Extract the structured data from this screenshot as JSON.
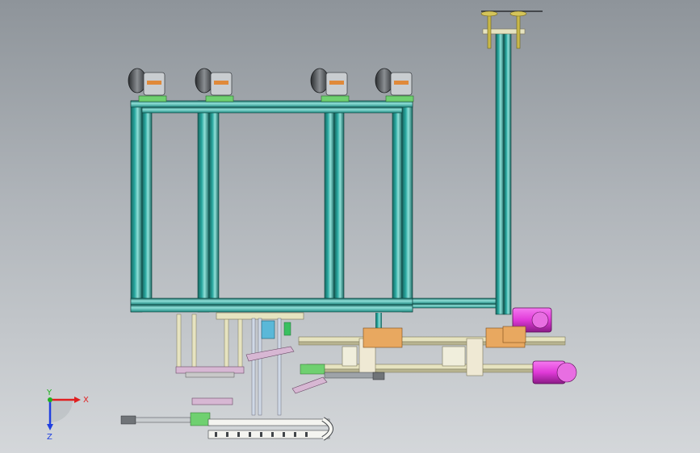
{
  "viewport": {
    "colors": {
      "background_top": "#8e949a",
      "background_bottom": "#d4d7da",
      "frame": "#2aa8a0",
      "frame_dark": "#16655f",
      "frame_light": "#8fe0d8",
      "motor": "#e03ad8",
      "motor_dark": "#8a1a86",
      "block": "#e8a860",
      "rail": "#e6e3c0",
      "caster": "#404448",
      "mount": "#6fd070"
    },
    "icons": [
      "caster-wheel-icon",
      "servo-motor-icon",
      "cable-chain-icon",
      "cylinder-icon"
    ]
  },
  "triad": {
    "x_label": "X",
    "y_label": "Y",
    "z_label": "Z",
    "x_color": "#e02020",
    "y_color": "#20b020",
    "z_color": "#2040e0"
  }
}
